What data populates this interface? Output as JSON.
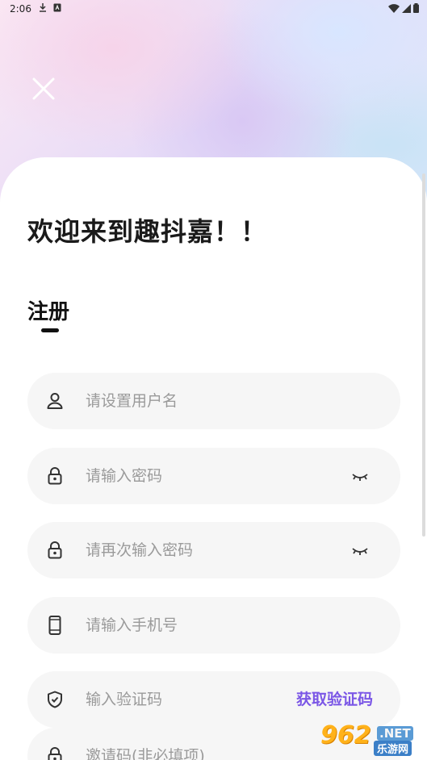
{
  "status_bar": {
    "time": "2:06"
  },
  "welcome_text": "欢迎来到趣抖嘉！！",
  "tab": {
    "title": "注册"
  },
  "fields": {
    "username": {
      "placeholder": "请设置用户名",
      "icon": "user-icon"
    },
    "password": {
      "placeholder": "请输入密码",
      "icon": "lock-icon"
    },
    "confirm_password": {
      "placeholder": "请再次输入密码",
      "icon": "lock-icon"
    },
    "phone": {
      "placeholder": "请输入手机号",
      "icon": "phone-icon"
    },
    "verify_code": {
      "placeholder": "输入验证码",
      "icon": "shield-icon",
      "action_label": "获取验证码"
    },
    "invite_code": {
      "placeholder": "邀请码(非必填项)",
      "icon": "lock-icon"
    }
  },
  "watermark": {
    "number": "962",
    "net": ".NET",
    "sub": "乐游网"
  },
  "colors": {
    "accent": "#7b57e6",
    "field_bg": "#f6f6f6",
    "placeholder": "#9a9a9a"
  }
}
